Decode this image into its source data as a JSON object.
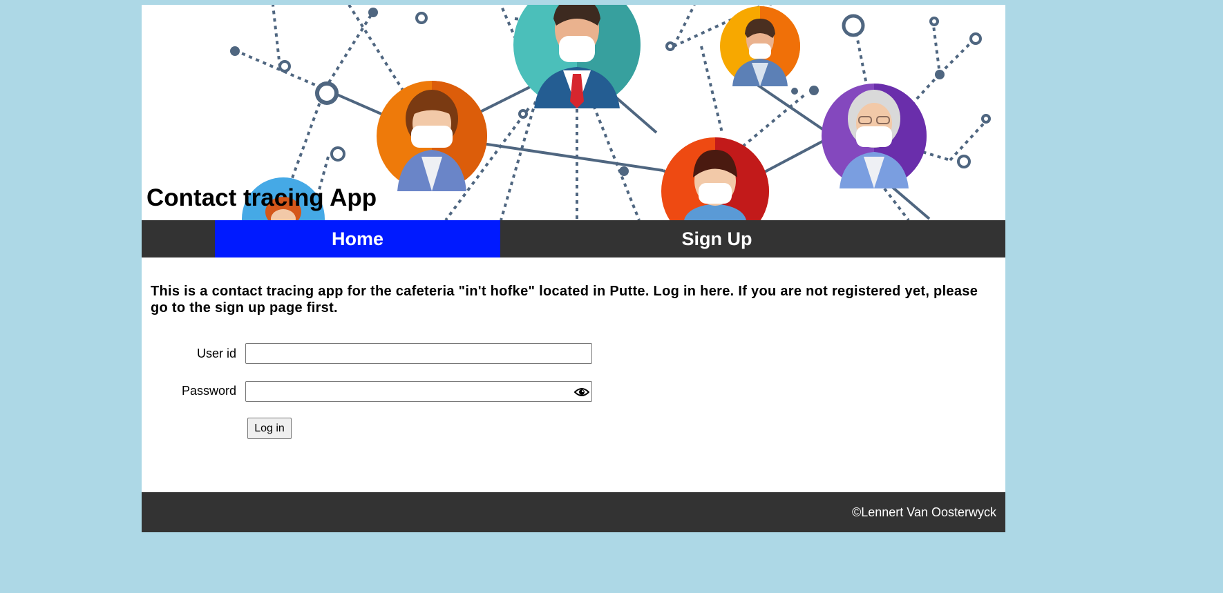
{
  "header": {
    "title": "Contact tracing App"
  },
  "nav": {
    "home": "Home",
    "signup": "Sign Up"
  },
  "intro": {
    "text": "This is a contact tracing app for the cafeteria \"in't hofke\" located in Putte. Log in here. If you are not registered yet, please go to the sign up page first."
  },
  "form": {
    "user_label": "User id",
    "user_value": "",
    "password_label": "Password",
    "password_value": "",
    "password_toggle_icon": "eye-icon",
    "login_label": "Log in"
  },
  "footer": {
    "copyright": "©Lennert Van Oosterwyck"
  },
  "colors": {
    "background": "#add8e6",
    "nav": "#333333",
    "nav_active": "#001aff",
    "footer": "#333333"
  }
}
